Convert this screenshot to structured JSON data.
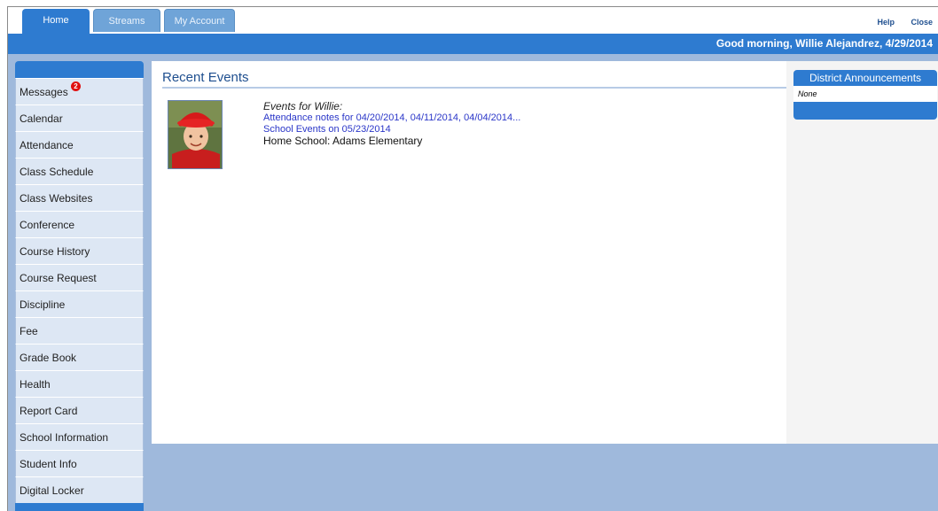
{
  "tabs": [
    {
      "label": "Home",
      "active": true
    },
    {
      "label": "Streams",
      "active": false
    },
    {
      "label": "My Account",
      "active": false
    }
  ],
  "top_links": {
    "help": "Help",
    "close": "Close"
  },
  "greeting": "Good morning, Willie Alejandrez, 4/29/2014",
  "sidebar": {
    "items": [
      {
        "label": "Messages",
        "badge": "2"
      },
      {
        "label": "Calendar"
      },
      {
        "label": "Attendance"
      },
      {
        "label": "Class Schedule"
      },
      {
        "label": "Class Websites"
      },
      {
        "label": "Conference"
      },
      {
        "label": "Course History"
      },
      {
        "label": "Course Request"
      },
      {
        "label": "Discipline"
      },
      {
        "label": "Fee"
      },
      {
        "label": "Grade Book"
      },
      {
        "label": "Health"
      },
      {
        "label": "Report Card"
      },
      {
        "label": "School Information"
      },
      {
        "label": "Student Info"
      },
      {
        "label": "Digital Locker"
      }
    ]
  },
  "main": {
    "title": "Recent Events",
    "events_label": "Events for Willie:",
    "attendance_link": "Attendance notes for 04/20/2014, 04/11/2014, 04/04/2014...",
    "school_events_link": "School Events on 05/23/2014",
    "home_school": "Home School: Adams Elementary"
  },
  "announcements": {
    "title": "District Announcements",
    "body": "None"
  },
  "colors": {
    "accent": "#2e7bd0",
    "background": "#9fb9dc",
    "link": "#2a36c8",
    "badge": "#e01010"
  }
}
